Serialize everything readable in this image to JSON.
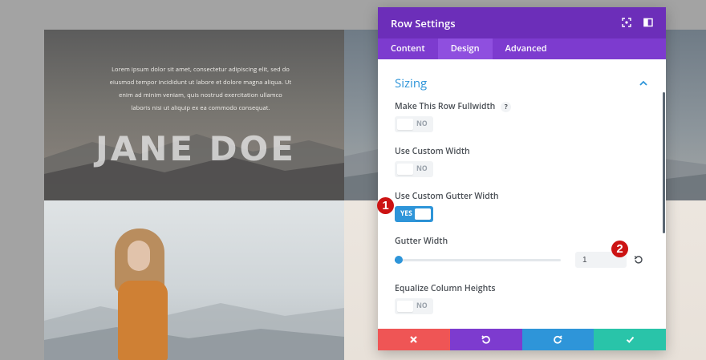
{
  "preview": {
    "paragraph": [
      "Lorem ipsum dolor sit amet, consectetur adipiscing elit, sed do",
      "eiusmod tempor incididunt ut labore et dolore magna aliqua. Ut",
      "enim ad minim veniam, quis nostrud exercitation ullamco",
      "laboris nisi ut aliquip ex ea commodo consequat."
    ],
    "name": "JANE DOE"
  },
  "modal": {
    "title": "Row Settings",
    "tabs": [
      "Content",
      "Design",
      "Advanced"
    ],
    "active_tab": "Design",
    "section": {
      "title": "Sizing"
    },
    "fields": {
      "fullwidth": {
        "label": "Make This Row Fullwidth",
        "help": "?",
        "toggle": "NO"
      },
      "custom_width": {
        "label": "Use Custom Width",
        "toggle": "NO"
      },
      "custom_gutter": {
        "label": "Use Custom Gutter Width",
        "toggle": "YES"
      },
      "gutter_width": {
        "label": "Gutter Width",
        "value": "1",
        "slider_fraction": 0.0
      },
      "equalize": {
        "label": "Equalize Column Heights",
        "toggle": "NO"
      }
    }
  },
  "callouts": [
    "1",
    "2"
  ],
  "colors": {
    "header": "#6c2eb9",
    "tabs": "#7d3bcf",
    "accent": "#2e95d9",
    "cancel": "#ef5555",
    "undo": "#7d3bcf",
    "redo": "#2e95d9",
    "save": "#29c4a9",
    "callout": "#cc1313"
  },
  "icons": {
    "header": [
      "fullscreen-icon",
      "sidebar-toggle-icon"
    ],
    "footer": [
      "close-icon",
      "undo-icon",
      "redo-icon",
      "check-icon"
    ]
  }
}
